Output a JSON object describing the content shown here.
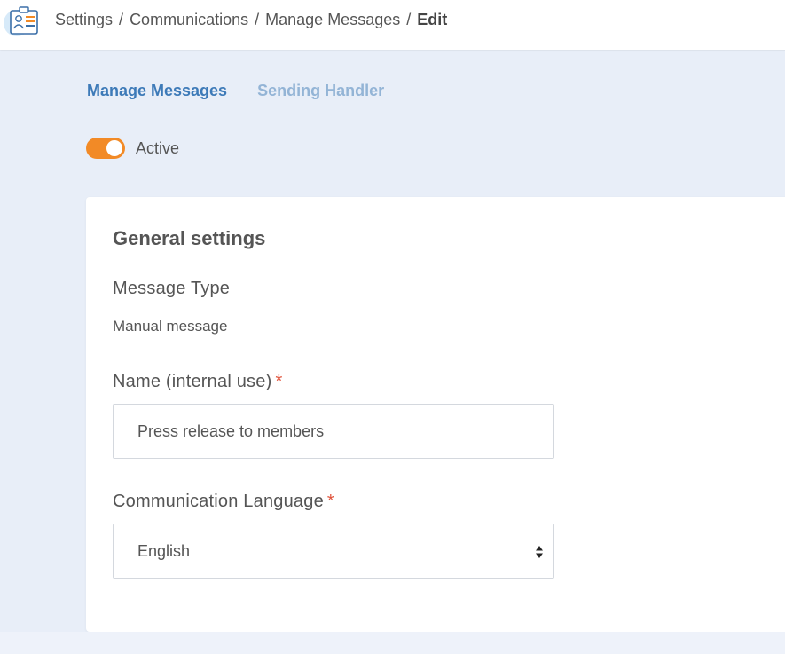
{
  "breadcrumb": {
    "items": [
      "Settings",
      "Communications",
      "Manage Messages"
    ],
    "separator": "/",
    "current": "Edit"
  },
  "tabs": {
    "active": "Manage Messages",
    "inactive": "Sending Handler"
  },
  "status": {
    "label": "Active",
    "enabled": true,
    "toggle_color": "#f28a26"
  },
  "general_settings": {
    "title": "General settings",
    "message_type": {
      "label": "Message Type",
      "value": "Manual message"
    },
    "name": {
      "label": "Name (internal use)",
      "required_mark": "*",
      "value": "Press release to members"
    },
    "language": {
      "label": "Communication Language",
      "required_mark": "*",
      "selected": "English"
    }
  },
  "colors": {
    "accent": "#3d7ab8",
    "tab_inactive": "#93b4d6",
    "required": "#e0533c",
    "background": "#e8eef8"
  }
}
